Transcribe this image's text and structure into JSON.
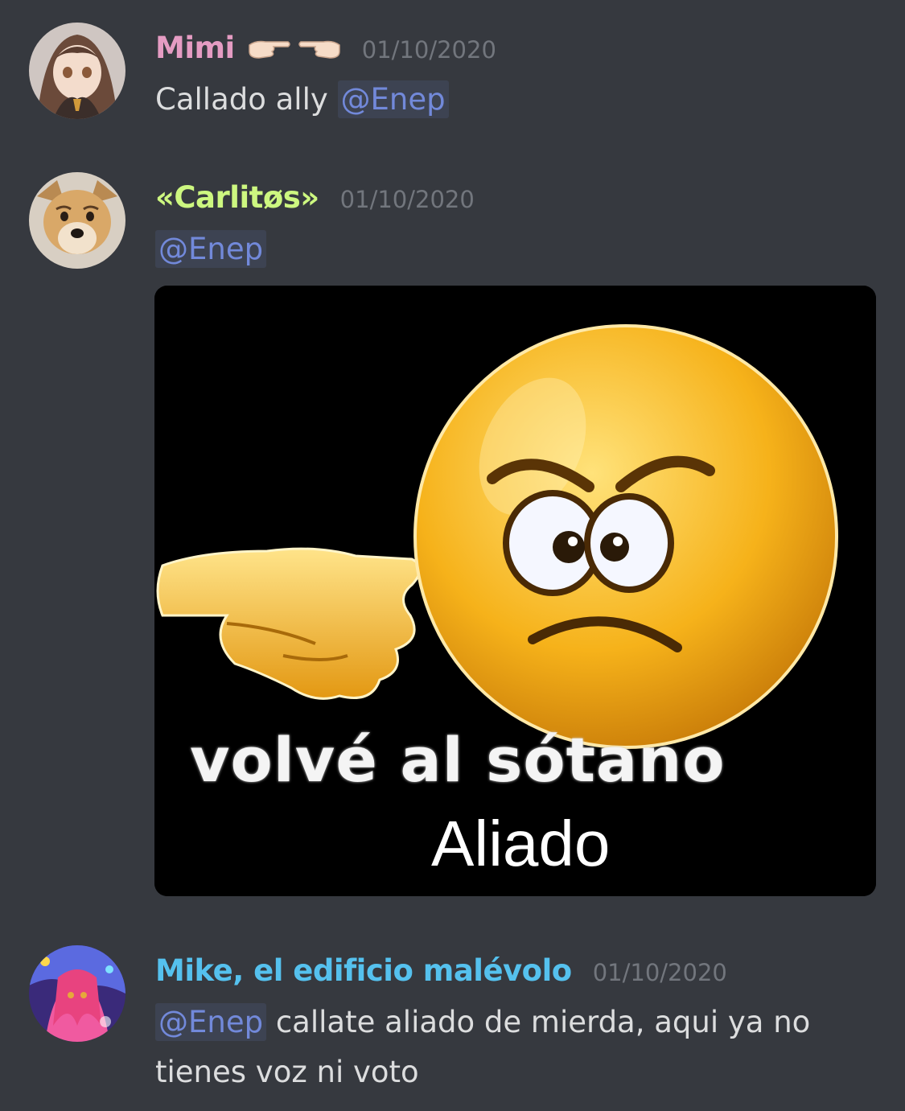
{
  "messages": [
    {
      "username": "Mimi",
      "username_color": "#e59cc3",
      "emoji": [
        "pointing-right-hand-icon",
        "pointing-left-hand-icon"
      ],
      "timestamp": "01/10/2020",
      "mention": "@Enep",
      "text_before": "Callado ally "
    },
    {
      "username": "«Carlitøs»",
      "username_color": "#cdf780",
      "timestamp": "01/10/2020",
      "mention": "@Enep",
      "attachment": {
        "caption_line1": "volvé al sótano",
        "caption_line2": "Aliado"
      }
    },
    {
      "username": "Mike, el edificio malévolo",
      "username_color": "#55c1ee",
      "timestamp": "01/10/2020",
      "mention": "@Enep",
      "text_after": " callate aliado de mierda, aqui ya no tienes voz ni voto"
    }
  ]
}
